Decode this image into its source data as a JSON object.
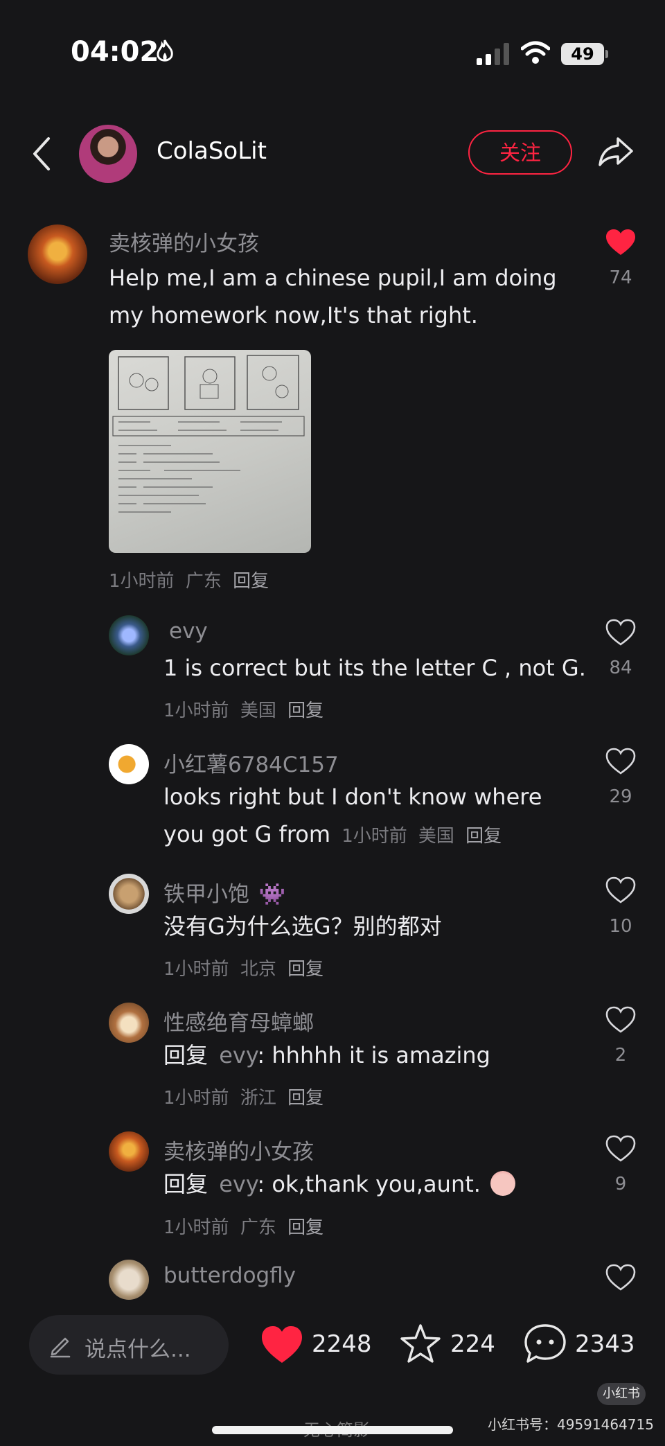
{
  "status_bar": {
    "time": "04:02",
    "battery": "49"
  },
  "header": {
    "author": "ColaSoLit",
    "follow_label": "关注"
  },
  "main_comment": {
    "user": "卖核弹的小女孩",
    "text_line1": "Help me,I am a chinese pupil,I am doing",
    "text_line2": "my homework now,It's that right.",
    "likes": "74",
    "liked": true,
    "time": "1小时前",
    "location": "广东",
    "reply_label": "回复"
  },
  "replies": [
    {
      "user": "evy",
      "text": "1 is correct but its the letter C , not G.",
      "time": "1小时前",
      "location": "美国",
      "reply_label": "回复",
      "likes": "84"
    },
    {
      "user": "小红薯6784C157",
      "text_line1": "looks right but I don't know where",
      "text_line2": "you got G from",
      "time": "1小时前",
      "location": "美国",
      "reply_label": "回复",
      "likes": "29"
    },
    {
      "user": "铁甲小饱",
      "text": "没有G为什么选G？别的都对",
      "time": "1小时前",
      "location": "北京",
      "reply_label": "回复",
      "likes": "10"
    },
    {
      "user": "性感绝育母蟑螂",
      "prefix": "回复",
      "quote": "evy",
      "text": ": hhhhh it is amazing",
      "time": "1小时前",
      "location": "浙江",
      "reply_label": "回复",
      "likes": "2"
    },
    {
      "user": "卖核弹的小女孩",
      "prefix": "回复",
      "quote": "evy",
      "text": ": ok,thank you,aunt.",
      "time": "1小时前",
      "location": "广东",
      "reply_label": "回复",
      "likes": "9"
    },
    {
      "user": "butterdogfly"
    }
  ],
  "bottom_bar": {
    "input_placeholder": "说点什么...",
    "likes": "2248",
    "stars": "224",
    "comments": "2343"
  },
  "watermark": {
    "badge": "小红书",
    "id": "小红书号：49591464715",
    "weibo": "无心简影"
  },
  "colors": {
    "accent": "#ff2442",
    "background": "#161618"
  }
}
